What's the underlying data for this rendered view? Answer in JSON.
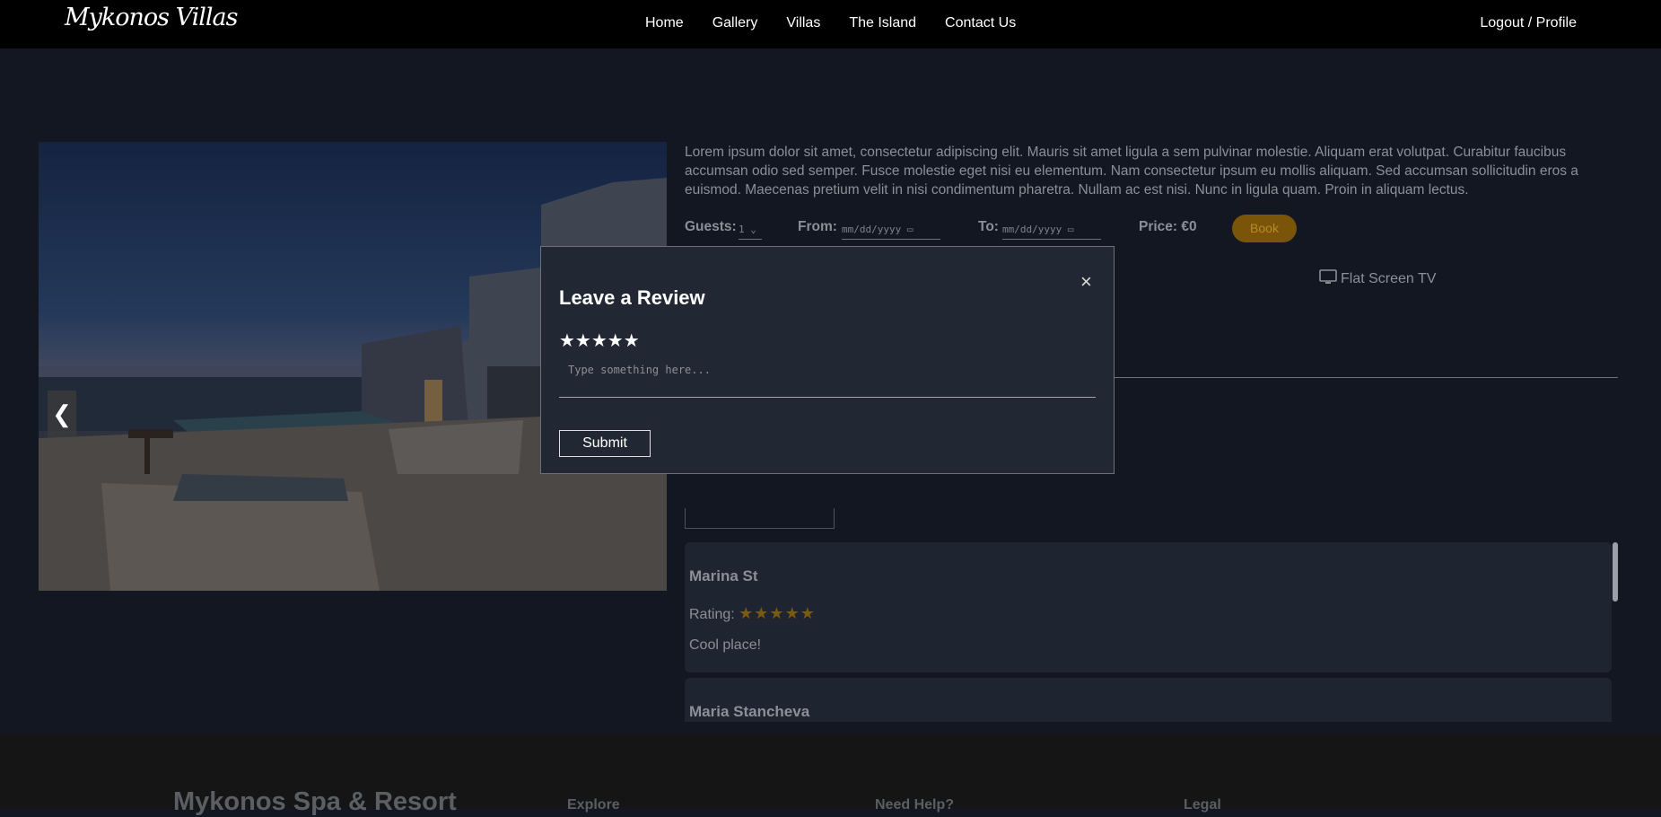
{
  "header": {
    "logo": "Mykonos Villas",
    "nav": [
      "Home",
      "Gallery",
      "Villas",
      "The Island",
      "Contact Us"
    ],
    "profile": "Logout / Profile"
  },
  "villa": {
    "description": "Lorem ipsum dolor sit amet, consectetur adipiscing elit. Mauris sit amet ligula a sem pulvinar molestie. Aliquam erat volutpat. Curabitur faucibus accumsan odio sed semper. Fusce molestie eget nisi eu elementum. Nam consectetur ipsum eu mollis aliquam. Sed accumsan sollicitudin eros a euismod. Maecenas pretium velit in nisi condimentum pharetra. Nullam ac est nisi. Nunc in ligula quam. Proin in aliquam lectus.",
    "guests_label": "Guests:",
    "guests_value": "1",
    "from_label": "From:",
    "from_placeholder": "mm/dd/yyyy",
    "to_label": "To:",
    "to_placeholder": "mm/dd/yyyy",
    "price_label": "Price: €0",
    "book_label": "Book",
    "amenity_tv": "Flat Screen TV",
    "carousel_prev": "❮"
  },
  "reviews": [
    {
      "name": "Marina St",
      "rating_label": "Rating:",
      "stars": "★★★★★",
      "text": "Cool place!"
    },
    {
      "name": "Maria Stancheva"
    }
  ],
  "footer": {
    "brand": "Mykonos Spa & Resort",
    "columns": [
      "Explore",
      "Need Help?",
      "Legal"
    ]
  },
  "modal": {
    "title": "Leave a Review",
    "close": "×",
    "stars": "★★★★★",
    "placeholder": "Type something here...",
    "submit": "Submit"
  },
  "colors": {
    "background": "#121721",
    "card": "#1f2530",
    "accent": "#7a5409",
    "modal": "#222833"
  }
}
